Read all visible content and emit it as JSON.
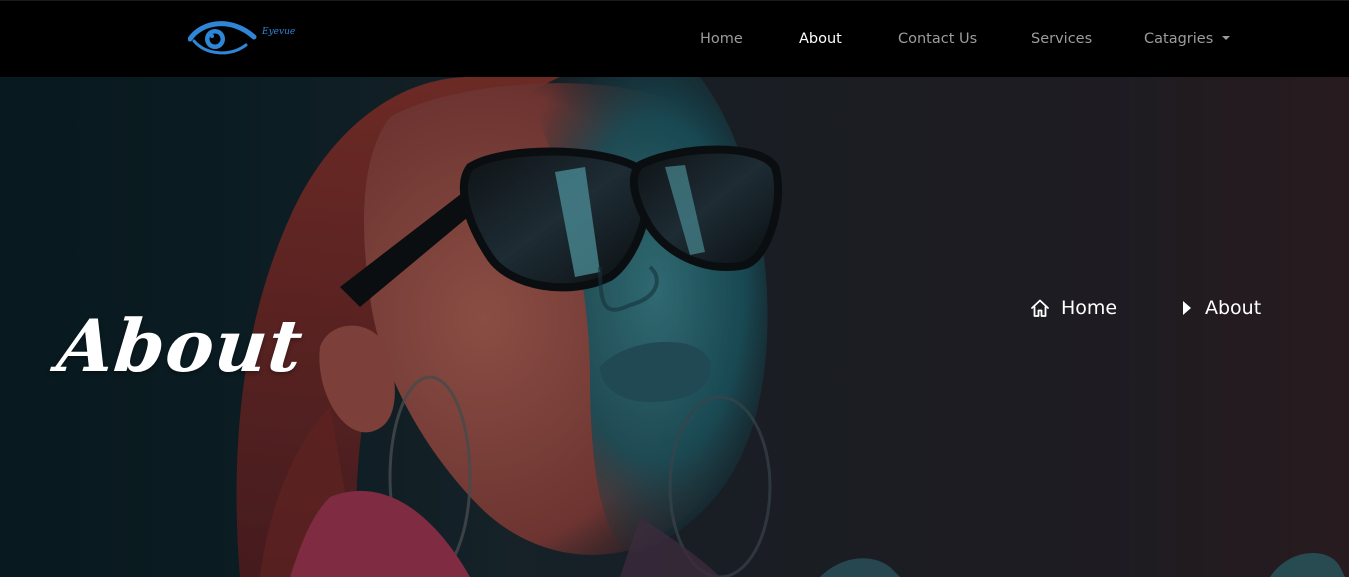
{
  "navbar": {
    "brand": {
      "logo_icon": "eye-icon",
      "logo_text": "Eyevue",
      "accent_color": "#2f86d6"
    },
    "links": [
      {
        "label": "Home",
        "active": false
      },
      {
        "label": "About",
        "active": true
      },
      {
        "label": "Contact Us",
        "active": false
      },
      {
        "label": "Services",
        "active": false
      },
      {
        "label": "Catagries",
        "active": false,
        "dropdown": true
      }
    ]
  },
  "hero": {
    "title": "About",
    "breadcrumb": [
      {
        "label": "Home",
        "icon": "home-icon"
      },
      {
        "label": "About",
        "icon": "caret-right-icon"
      }
    ],
    "image_subject": "woman-with-sunglasses-photo"
  },
  "colors": {
    "navbar_bg": "#000000",
    "nav_text": "#9c9c9c",
    "nav_text_active": "#ffffff",
    "hero_text": "#ffffff"
  }
}
